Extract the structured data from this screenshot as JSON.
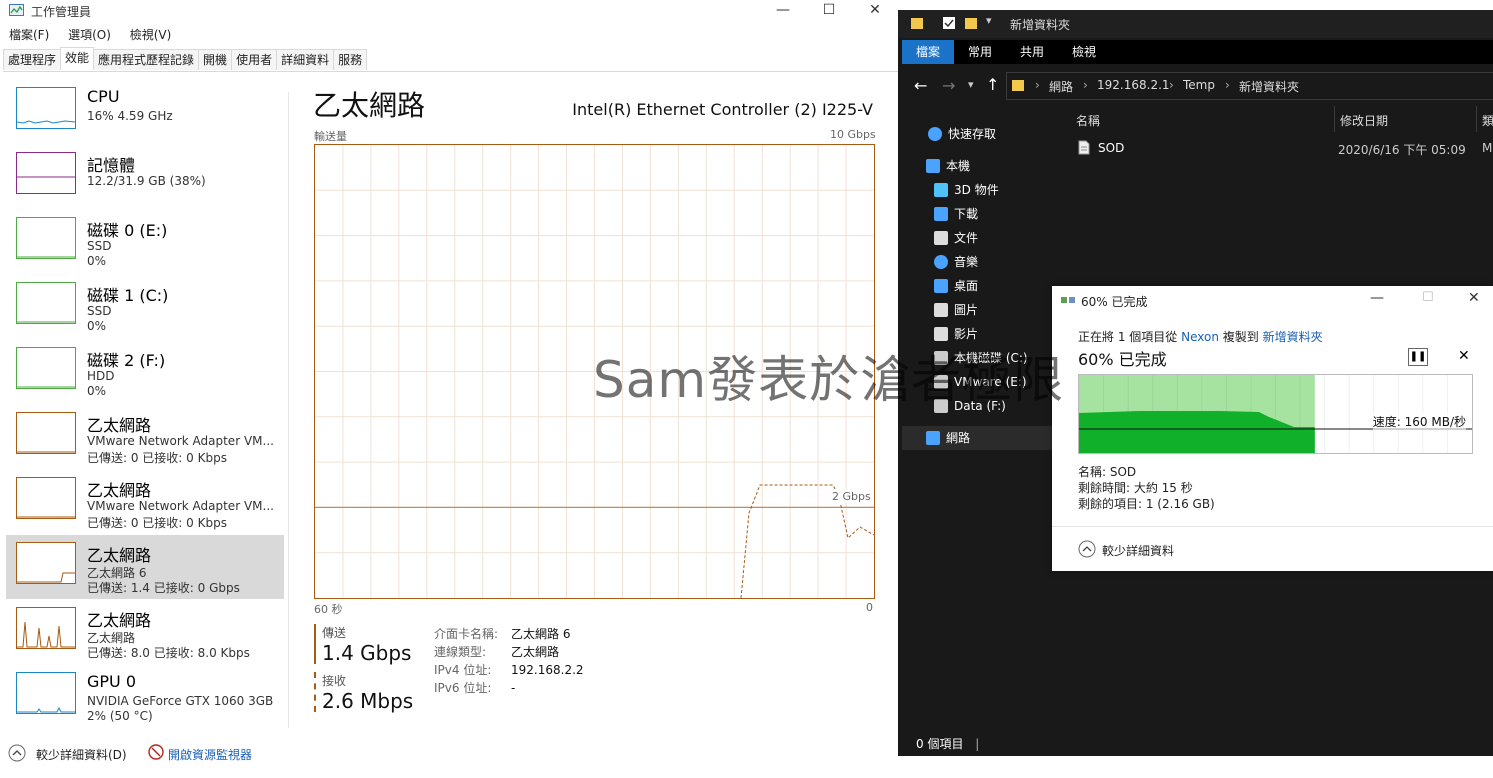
{
  "task_manager": {
    "title": "工作管理員",
    "menu": [
      "檔案(F)",
      "選項(O)",
      "檢視(V)"
    ],
    "tabs": [
      "處理程序",
      "效能",
      "應用程式歷程記錄",
      "開機",
      "使用者",
      "詳細資料",
      "服務"
    ],
    "active_tab": 1,
    "sidebar": [
      {
        "title": "CPU",
        "sub1": "16% 4.59 GHz",
        "sub2": "",
        "color": "#1b87c9"
      },
      {
        "title": "記憶體",
        "sub1": "12.2/31.9 GB (38%)",
        "sub2": "",
        "color": "#8b2a8b"
      },
      {
        "title": "磁碟 0 (E:)",
        "sub1": "SSD",
        "sub2": "0%",
        "color": "#4daa42"
      },
      {
        "title": "磁碟 1 (C:)",
        "sub1": "SSD",
        "sub2": "0%",
        "color": "#4daa42"
      },
      {
        "title": "磁碟 2 (F:)",
        "sub1": "HDD",
        "sub2": "0%",
        "color": "#4daa42"
      },
      {
        "title": "乙太網路",
        "sub1": "VMware Network Adapter VM...",
        "sub2": "已傳送: 0 已接收: 0 Kbps",
        "color": "#a75a12"
      },
      {
        "title": "乙太網路",
        "sub1": "VMware Network Adapter VM...",
        "sub2": "已傳送: 0 已接收: 0 Kbps",
        "color": "#a75a12"
      },
      {
        "title": "乙太網路",
        "sub1": "乙太網路 6",
        "sub2": "已傳送: 1.4 已接收: 0 Gbps",
        "color": "#a75a12"
      },
      {
        "title": "乙太網路",
        "sub1": "乙太網路",
        "sub2": "已傳送: 8.0 已接收: 8.0 Kbps",
        "color": "#a75a12"
      },
      {
        "title": "GPU 0",
        "sub1": "NVIDIA GeForce GTX 1060 3GB",
        "sub2": "2% (50 °C)",
        "color": "#1b87c9"
      }
    ],
    "selected_index": 7,
    "heading": "乙太網路",
    "adapter": "Intel(R) Ethernet Controller (2) I225-V",
    "graph": {
      "label": "輸送量",
      "max": "10 Gbps",
      "mid": "2 Gbps",
      "x_left": "60 秒",
      "x_right": "0"
    },
    "stats": {
      "send_label": "傳送",
      "send_value": "1.4 Gbps",
      "recv_label": "接收",
      "recv_value": "2.6 Mbps"
    },
    "details": [
      {
        "key": "介面卡名稱:",
        "value": "乙太網路 6"
      },
      {
        "key": "連線類型:",
        "value": "乙太網路"
      },
      {
        "key": "IPv4 位址:",
        "value": "192.168.2.2"
      },
      {
        "key": "IPv6 位址:",
        "value": "-"
      }
    ],
    "bottom": {
      "fewer": "較少詳細資料(D)",
      "monitor": "開啟資源監視器"
    }
  },
  "explorer": {
    "title": "新增資料夾",
    "ribbon": [
      "檔案",
      "常用",
      "共用",
      "檢視"
    ],
    "breadcrumb": [
      "網路",
      "192.168.2.1",
      "Temp",
      "新增資料夾"
    ],
    "nav": [
      {
        "label": "快速存取",
        "icon": "star-icon",
        "color": "#4aa3ff"
      },
      {
        "label": "本機",
        "icon": "computer-icon",
        "color": "#4aa3ff"
      },
      {
        "label": "3D 物件",
        "icon": "cube-icon",
        "color": "#4fc3f7"
      },
      {
        "label": "下載",
        "icon": "download-icon",
        "color": "#4aa3ff"
      },
      {
        "label": "文件",
        "icon": "document-icon",
        "color": "#dddddd"
      },
      {
        "label": "音樂",
        "icon": "music-icon",
        "color": "#4aa3ff"
      },
      {
        "label": "桌面",
        "icon": "desktop-icon",
        "color": "#4aa3ff"
      },
      {
        "label": "圖片",
        "icon": "picture-icon",
        "color": "#dddddd"
      },
      {
        "label": "影片",
        "icon": "video-icon",
        "color": "#dddddd"
      },
      {
        "label": "本機磁碟 (C:)",
        "icon": "drive-icon",
        "color": "#cccccc"
      },
      {
        "label": "VMware (E:)",
        "icon": "drive-icon",
        "color": "#cccccc"
      },
      {
        "label": "Data (F:)",
        "icon": "drive-icon",
        "color": "#cccccc"
      },
      {
        "label": "網路",
        "icon": "network-icon",
        "color": "#4aa3ff"
      }
    ],
    "columns": {
      "name": "名稱",
      "date": "修改日期",
      "type": "類"
    },
    "files": [
      {
        "name": "SOD",
        "date": "2020/6/16 下午 05:09",
        "type": "M"
      }
    ],
    "status": "0 個項目"
  },
  "copy_dialog": {
    "title": "60% 已完成",
    "line1_pre": "正在將 1 個項目從 ",
    "source": "Nexon",
    "line1_mid": " 複製到 ",
    "dest": "新增資料夾",
    "progress_label": "60% 已完成",
    "progress": 0.6,
    "speed": "速度: 160 MB/秒",
    "name": "名稱: SOD",
    "remaining_time": "剩餘時間: 大約 15 秒",
    "remaining_items": "剩餘的項目: 1 (2.16 GB)",
    "fewer": "較少詳細資料"
  },
  "watermark": "Sam發表於滄者極限"
}
